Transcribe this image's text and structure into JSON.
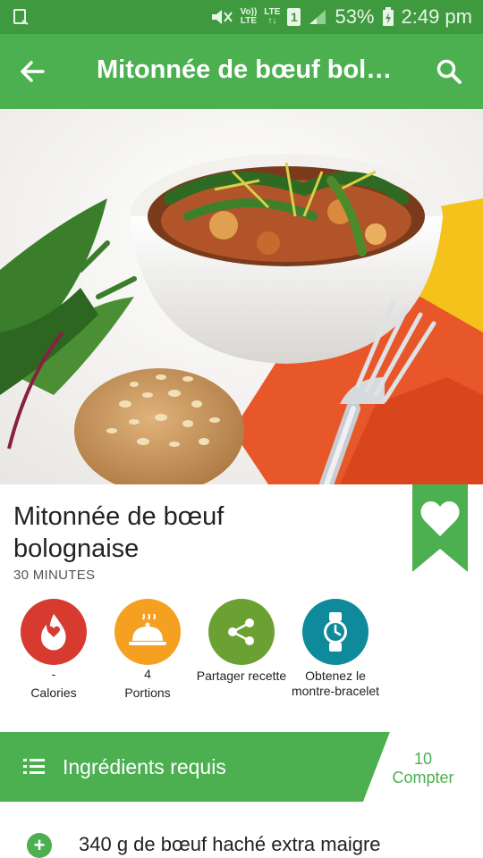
{
  "status_bar": {
    "network_top": "Vo))",
    "network_bottom": "LTE",
    "lte_label": "LTE",
    "sim_slot": "1",
    "battery": "53%",
    "time": "2:49 pm"
  },
  "toolbar": {
    "title": "Mitonnée de bœuf bolo...",
    "back_icon": "arrow-left-icon",
    "search_icon": "search-icon"
  },
  "recipe": {
    "title": "Mitonnée de bœuf bolognaise",
    "time": "30 MINUTES"
  },
  "actions": [
    {
      "value": "-",
      "label": "Calories",
      "icon": "calories-flame-icon",
      "color": "#d73b30"
    },
    {
      "value": "4",
      "label": "Portions",
      "icon": "serving-cloche-icon",
      "color": "#f5a020"
    },
    {
      "value": "",
      "label": "Partager recette",
      "icon": "share-icon",
      "color": "#6ba032"
    },
    {
      "value": "",
      "label": "Obtenez le montre-bracelet",
      "icon": "watch-icon",
      "color": "#0e8a9a"
    }
  ],
  "ingredients_bar": {
    "title": "Ingrédients requis",
    "count_value": "10",
    "count_label": "Compter"
  },
  "ingredients": [
    {
      "text": "340 g de bœuf haché extra maigre"
    }
  ],
  "colors": {
    "primary": "#4caf50",
    "status_bar": "#3f9a3f",
    "ribbon": "#4caf50"
  }
}
